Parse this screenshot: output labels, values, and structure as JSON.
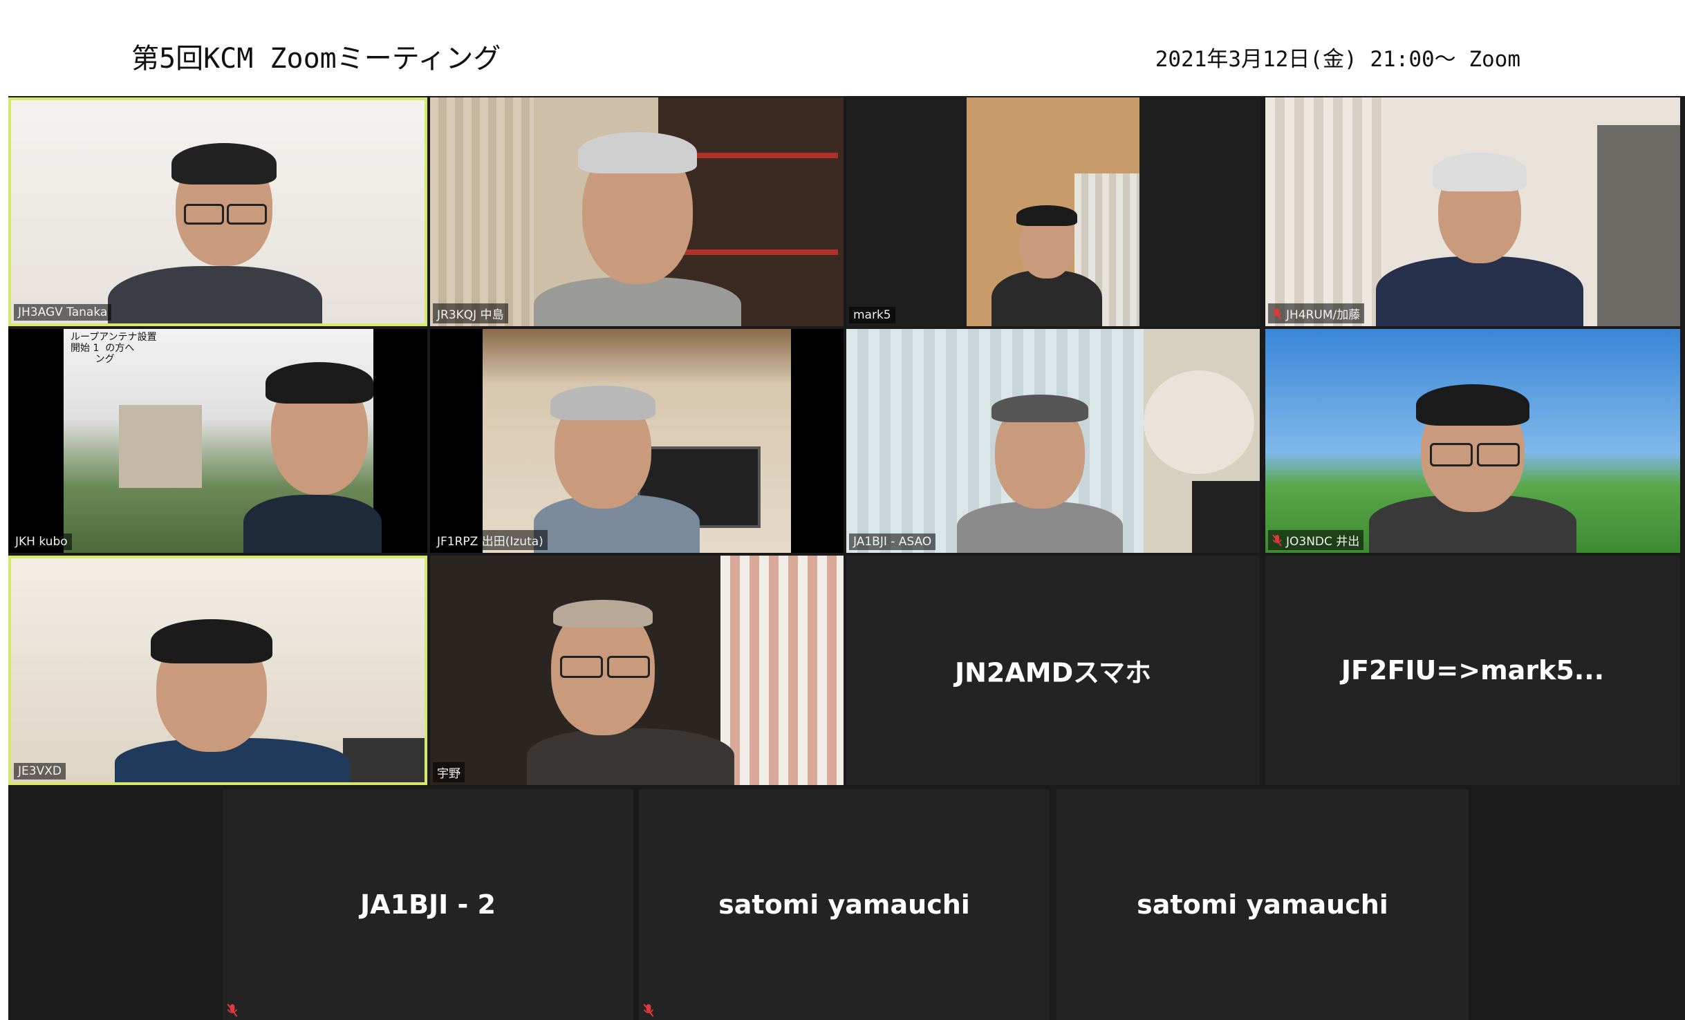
{
  "header": {
    "title": "第5回KCM Zoomミーティング",
    "date": "2021年3月12日(金) 21:00～ Zoom"
  },
  "participants": [
    {
      "name": "JH3AGV Tanaka",
      "muted": false,
      "speaking": true
    },
    {
      "name": "JR3KQJ 中島",
      "muted": false
    },
    {
      "name": "mark5",
      "muted": false
    },
    {
      "name": "JH4RUM/加藤",
      "muted": true
    },
    {
      "name": "JKH kubo",
      "muted": false,
      "overlay_text": "ループアンテナ設置\n開始 1  の方へ\n        ング"
    },
    {
      "name": "JF1RPZ 出田(Izuta)",
      "muted": false
    },
    {
      "name": "JA1BJI - ASAO",
      "muted": false
    },
    {
      "name": "JO3NDC 井出",
      "muted": true
    },
    {
      "name": "JE3VXD",
      "muted": false,
      "speaking": true
    },
    {
      "name": "宇野",
      "muted": false
    },
    {
      "name": "JN2AMDスマホ",
      "video_off": true,
      "muted": false
    },
    {
      "name": "JF2FIU=>mark5...",
      "video_off": true,
      "muted": false
    },
    {
      "name": "JA1BJI - 2",
      "video_off": true,
      "muted": true
    },
    {
      "name": "satomi yamauchi",
      "video_off": true,
      "muted": true
    },
    {
      "name": "satomi yamauchi",
      "video_off": true,
      "muted": false
    }
  ],
  "colors": {
    "speaking_border": "#d7e86b",
    "tile_bg": "#232323",
    "mute_red": "#e0393e"
  },
  "icons": {
    "mute": "microphone-muted-icon"
  }
}
